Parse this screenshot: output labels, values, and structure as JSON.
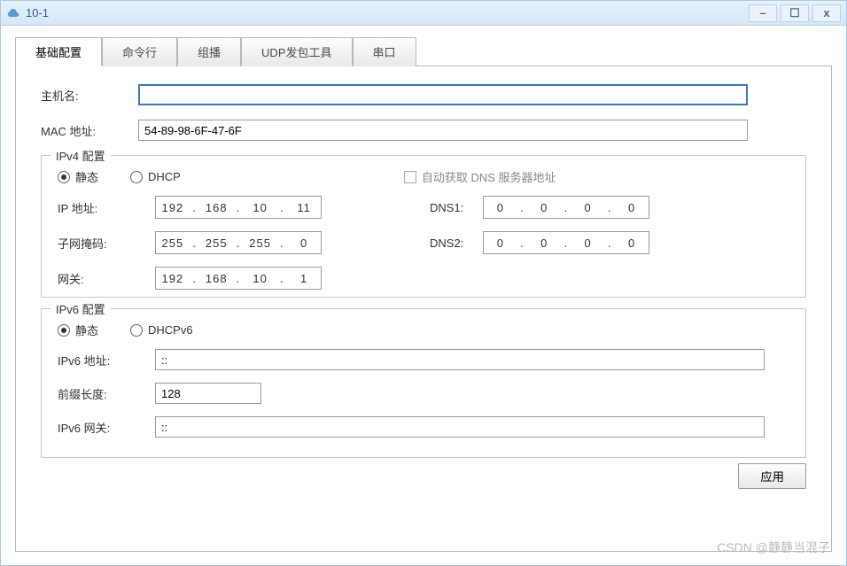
{
  "window": {
    "title": "10-1"
  },
  "tabs": {
    "basic": "基础配置",
    "cmdline": "命令行",
    "multicast": "组播",
    "udp": "UDP发包工具",
    "serial": "串口"
  },
  "labels": {
    "hostname": "主机名:",
    "mac": "MAC 地址:",
    "ipv4_group": "IPv4 配置",
    "static": "静态",
    "dhcp": "DHCP",
    "auto_dns": "自动获取 DNS 服务器地址",
    "ip": "IP 地址:",
    "subnet": "子网掩码:",
    "gateway": "网关:",
    "dns1": "DNS1:",
    "dns2": "DNS2:",
    "ipv6_group": "IPv6 配置",
    "dhcpv6": "DHCPv6",
    "ipv6_addr": "IPv6 地址:",
    "prefix": "前缀长度:",
    "ipv6_gw": "IPv6 网关:",
    "apply": "应用"
  },
  "values": {
    "hostname": "",
    "mac": "54-89-98-6F-47-6F",
    "ip": [
      "192",
      "168",
      "10",
      "11"
    ],
    "subnet": [
      "255",
      "255",
      "255",
      "0"
    ],
    "gateway": [
      "192",
      "168",
      "10",
      "1"
    ],
    "dns1": [
      "0",
      "0",
      "0",
      "0"
    ],
    "dns2": [
      "0",
      "0",
      "0",
      "0"
    ],
    "ipv6_addr": "::",
    "prefix": "128",
    "ipv6_gw": "::"
  },
  "watermark": "CSDN @静静当混子"
}
